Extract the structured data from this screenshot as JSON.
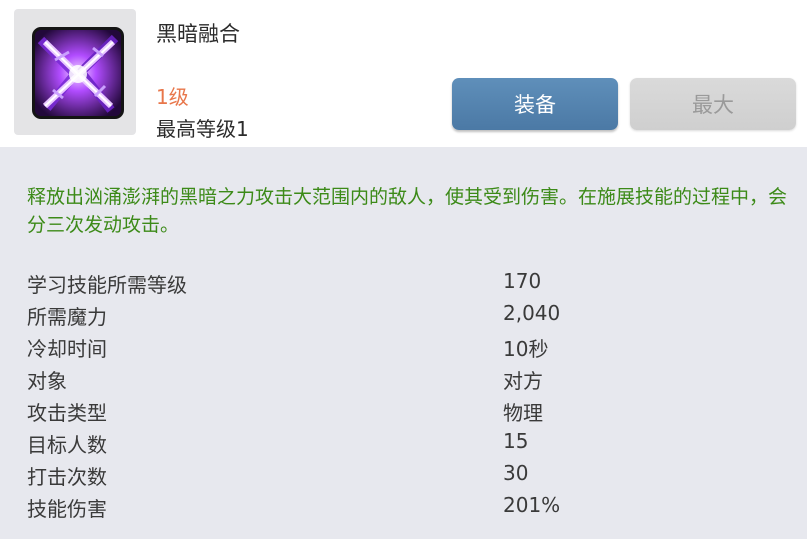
{
  "skill": {
    "icon": "dark-fusion-skill-icon",
    "name": "黑暗融合",
    "level": "1级",
    "max_level": "最高等级1"
  },
  "buttons": {
    "equip": "装备",
    "max": "最大"
  },
  "description": "释放出汹涌澎湃的黑暗之力攻击大范围内的敌人，使其受到伤害。在施展技能的过程中，会分三次发动攻击。",
  "stats": [
    {
      "label": "学习技能所需等级",
      "value": "170"
    },
    {
      "label": "所需魔力",
      "value": "2,040"
    },
    {
      "label": "冷却时间",
      "value": "10秒"
    },
    {
      "label": "对象",
      "value": "对方"
    },
    {
      "label": "攻击类型",
      "value": "物理"
    },
    {
      "label": "目标人数",
      "value": "15"
    },
    {
      "label": "打击次数",
      "value": "30"
    },
    {
      "label": "技能伤害",
      "value": "201%"
    }
  ],
  "colors": {
    "level": "#e8764a",
    "description": "#3c8a18",
    "equip_button": "#5585b2",
    "max_button": "#d4d4d4",
    "panel": "#e7e8ee"
  }
}
